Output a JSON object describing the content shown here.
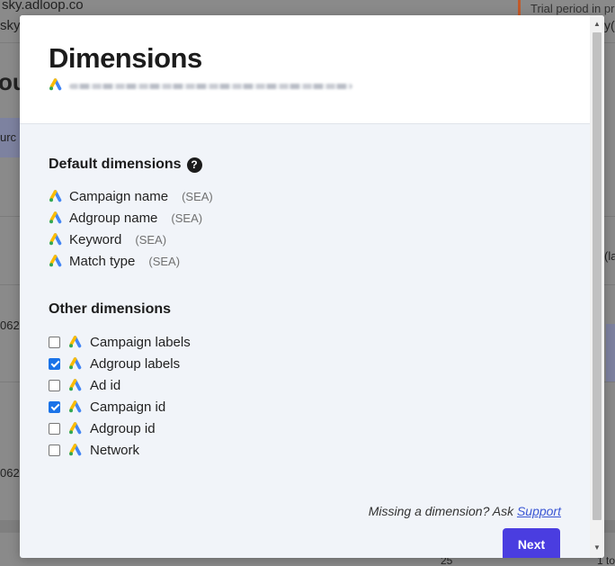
{
  "background": {
    "url_fragment": "sky.adloop.co",
    "url_fragment2": "sky(",
    "trial_notice": "Trial period in pr",
    "heading_fragment": "ou",
    "tab_fragment": "urc",
    "right_fragment": "y(",
    "right_fragment2": "(la",
    "row_fragment1": "062",
    "row_fragment2": "062",
    "pagination_fragment": "25",
    "pagination_fragment2": "1 to"
  },
  "modal": {
    "title": "Dimensions",
    "default_section": {
      "title": "Default dimensions",
      "items": [
        {
          "label": "Campaign name",
          "tag": "(SEA)"
        },
        {
          "label": "Adgroup name",
          "tag": "(SEA)"
        },
        {
          "label": "Keyword",
          "tag": "(SEA)"
        },
        {
          "label": "Match type",
          "tag": "(SEA)"
        }
      ]
    },
    "other_section": {
      "title": "Other dimensions",
      "items": [
        {
          "label": "Campaign labels",
          "checked": false
        },
        {
          "label": "Adgroup labels",
          "checked": true
        },
        {
          "label": "Ad id",
          "checked": false
        },
        {
          "label": "Campaign id",
          "checked": true
        },
        {
          "label": "Adgroup id",
          "checked": false
        },
        {
          "label": "Network",
          "checked": false
        }
      ]
    },
    "missing_prompt": "Missing a dimension? Ask",
    "support_link": "Support",
    "next_button": "Next"
  },
  "icons": {
    "ads": "google-ads-icon",
    "help": "question-circle-icon"
  },
  "colors": {
    "primary_button": "#4a3de0",
    "link": "#3a56d4",
    "checkbox_checked": "#1a73e8",
    "ads_blue": "#4285f4",
    "ads_yellow": "#fbbc04",
    "ads_green": "#34a853"
  }
}
